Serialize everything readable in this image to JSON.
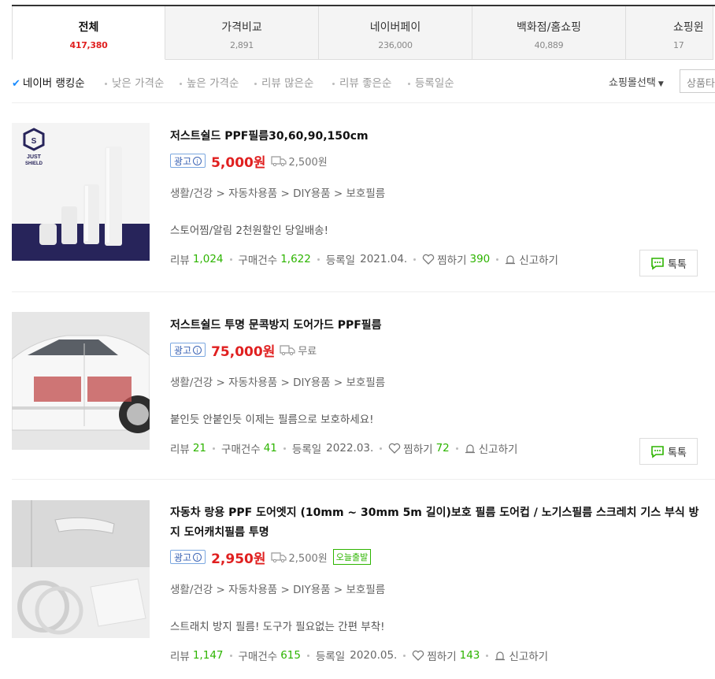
{
  "tabs": [
    {
      "name": "전체",
      "count": "417,380",
      "active": true
    },
    {
      "name": "가격비교",
      "count": "2,891"
    },
    {
      "name": "네이버페이",
      "count": "236,000"
    },
    {
      "name": "백화점/홈쇼핑",
      "count": "40,889"
    },
    {
      "name": "쇼핑윈",
      "count": "17"
    }
  ],
  "sort": {
    "items": [
      "네이버 랭킹순",
      "낮은 가격순",
      "높은 가격순",
      "리뷰 많은순",
      "리뷰 좋은순",
      "등록일순"
    ],
    "mall_select": "쇼핑몰선택",
    "product_filter_placeholder": "상품타"
  },
  "labels": {
    "ad": "광고",
    "review": "리뷰",
    "purchase": "구매건수",
    "registered": "등록일",
    "wish": "찜하기",
    "report": "신고하기",
    "talk": "톡톡"
  },
  "products": [
    {
      "title": "저스트쉴드 PPF필름30,60,90,150cm",
      "price": "5,000원",
      "shipping": "2,500원",
      "category": "생활/건강 > 자동차용품 > DIY용품 > 보호필름",
      "desc": "스토어찜/알림 2천원할인 당일배송!",
      "reviews": "1,024",
      "purchases": "1,622",
      "date": "2021.04.",
      "wish": "390",
      "brand_logo": "JUST SHIELD"
    },
    {
      "title": "저스트쉴드 투명 문콕방지 도어가드 PPF필름",
      "price": "75,000원",
      "shipping": "무료",
      "category": "생활/건강 > 자동차용품 > DIY용품 > 보호필름",
      "desc": "붙인듯 안붙인듯 이제는 필름으로 보호하세요!",
      "reviews": "21",
      "purchases": "41",
      "date": "2022.03.",
      "wish": "72"
    },
    {
      "title": "자동차 랑용 PPF 도어엣지 (10mm ~ 30mm 5m 길이)보호 필름 도어컵 / 노기스필름 스크레치 기스 부식 방지 도어캐치필름 투명",
      "price": "2,950원",
      "shipping": "2,500원",
      "today_badge": "오늘출발",
      "category": "생활/건강 > 자동차용품 > DIY용품 > 보호필름",
      "desc": "스트래치 방지 필름! 도구가 필요없는 간편 부착!",
      "reviews": "1,147",
      "purchases": "615",
      "date": "2020.05.",
      "wish": "143"
    }
  ],
  "colors": {
    "price": "#e02020",
    "accent_green": "#2db400",
    "ad_blue": "#3c64b4"
  }
}
